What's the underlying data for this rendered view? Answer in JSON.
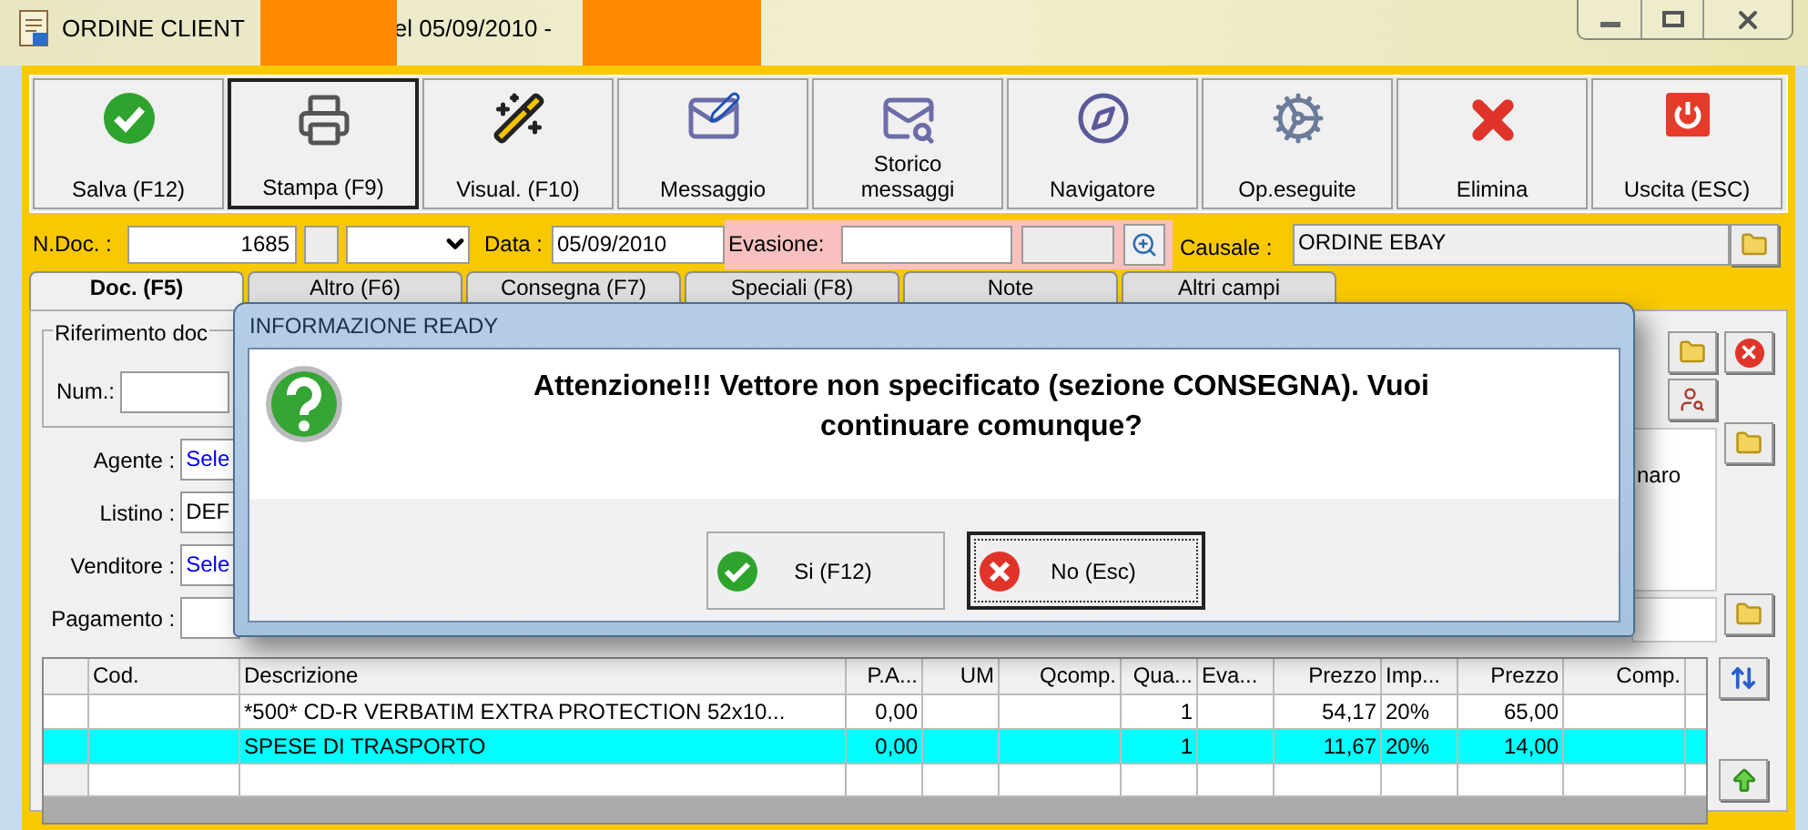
{
  "window": {
    "title_start": "ORDINE CLIENT",
    "title_end": "el 05/09/2010 -"
  },
  "toolbar": [
    {
      "label": "Salva (F12)",
      "kind": "save",
      "pressed": false
    },
    {
      "label": "Stampa (F9)",
      "kind": "print",
      "pressed": true
    },
    {
      "label": "Visual. (F10)",
      "kind": "wand",
      "pressed": false
    },
    {
      "label": "Messaggio",
      "kind": "message",
      "pressed": false
    },
    {
      "label": "Storico messaggi",
      "kind": "history",
      "pressed": false
    },
    {
      "label": "Navigatore",
      "kind": "compass",
      "pressed": false
    },
    {
      "label": "Op.eseguite",
      "kind": "gears",
      "pressed": false
    },
    {
      "label": "Elimina",
      "kind": "delete",
      "pressed": false
    },
    {
      "label": "Uscita (ESC)",
      "kind": "exit",
      "pressed": false
    }
  ],
  "header": {
    "ndoc_label": "N.Doc. :",
    "ndoc_value": "1685",
    "data_label": "Data :",
    "data_value": "05/09/2010",
    "evasione_label": "Evasione:",
    "causale_label": "Causale :",
    "causale_value": "ORDINE EBAY"
  },
  "tabs": [
    {
      "label": "Doc. (F5)",
      "selected": true
    },
    {
      "label": "Altro (F6)",
      "selected": false
    },
    {
      "label": "Consegna (F7)",
      "selected": false
    },
    {
      "label": "Speciali (F8)",
      "selected": false
    },
    {
      "label": "Note",
      "selected": false
    },
    {
      "label": "Altri campi",
      "selected": false
    }
  ],
  "form": {
    "group_legend": "Riferimento doc",
    "num_label": "Num.:",
    "fields": [
      {
        "label": "Agente :",
        "value": "Sele",
        "kind": "selector"
      },
      {
        "label": "Listino :",
        "value": "DEF",
        "kind": "text"
      },
      {
        "label": "Venditore :",
        "value": "Sele",
        "kind": "selector"
      },
      {
        "label": "Pagamento :",
        "kind": "text"
      }
    ],
    "side_text": "naro"
  },
  "dialog": {
    "title": "INFORMAZIONE READY",
    "message": "Attenzione!!! Vettore non specificato (sezione CONSEGNA). Vuoi continuare comunque?",
    "buttons": [
      {
        "label": "Si (F12)",
        "kind": "yes",
        "focused": false
      },
      {
        "label": "No (Esc)",
        "kind": "no",
        "focused": true
      }
    ]
  },
  "table": {
    "columns": [
      "Cod.",
      "Descrizione",
      "P.A...",
      "UM",
      "Qcomp.",
      "Qua...",
      "Eva...",
      "Prezzo",
      "Imp...",
      "Prezzo",
      "Comp."
    ],
    "rows": [
      {
        "selected": false,
        "cells": [
          null,
          "*500* CD-R VERBATIM EXTRA PROTECTION 52x10...",
          "0,00",
          null,
          null,
          "1",
          null,
          "54,17",
          "20%",
          "65,00",
          null
        ]
      },
      {
        "selected": true,
        "cells": [
          null,
          "SPESE DI TRASPORTO",
          "0,00",
          null,
          null,
          "1",
          null,
          "11,67",
          "20%",
          "14,00",
          null
        ]
      }
    ]
  }
}
